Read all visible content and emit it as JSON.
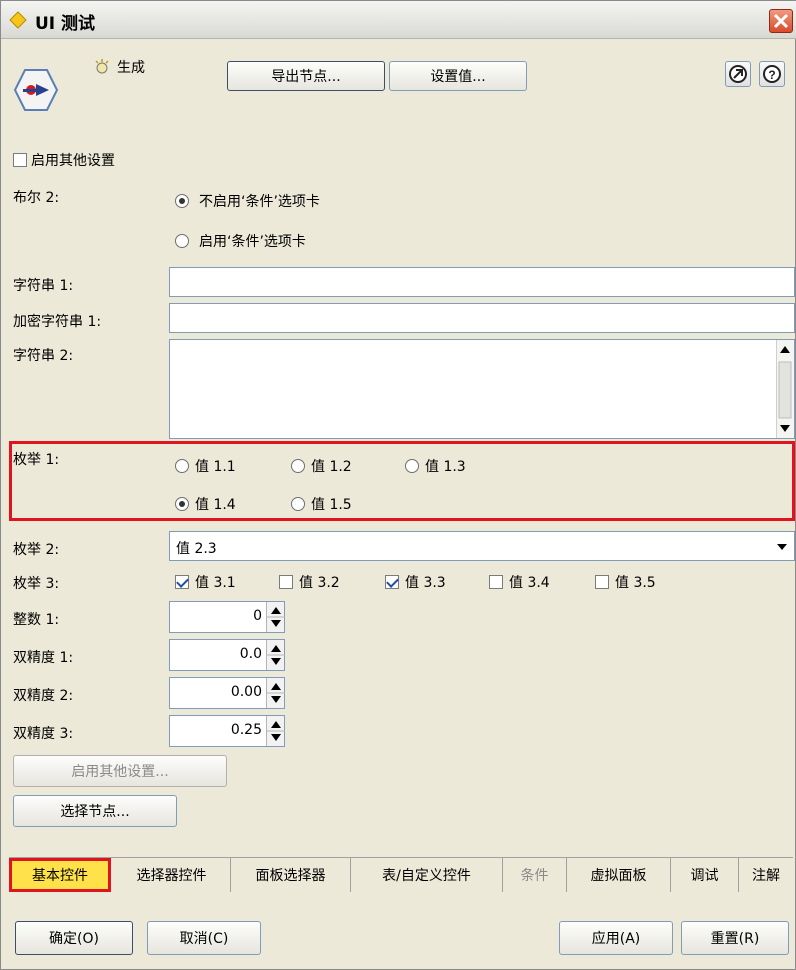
{
  "window": {
    "title": "UI 测试"
  },
  "toolbar": {
    "generate_label": "生成",
    "export_node_label": "导出节点...",
    "set_value_label": "设置值..."
  },
  "form": {
    "enable_other_settings_label": "启用其他设置",
    "bool2_label": "布尔 2:",
    "bool2_options": [
      "不启用‘条件’选项卡",
      "启用‘条件’选项卡"
    ],
    "bool2_selected": 0,
    "string1_label": "字符串 1:",
    "string1_value": "",
    "enc_string1_label": "加密字符串 1:",
    "enc_string1_value": "",
    "string2_label": "字符串 2:",
    "string2_value": "",
    "enum1_label": "枚举 1:",
    "enum1_options": [
      "值 1.1",
      "值 1.2",
      "值 1.3",
      "值 1.4",
      "值 1.5"
    ],
    "enum1_selected": 3,
    "enum2_label": "枚举 2:",
    "enum2_value": "值 2.3",
    "enum3_label": "枚举 3:",
    "enum3_options": [
      {
        "label": "值 3.1",
        "checked": true
      },
      {
        "label": "值 3.2",
        "checked": false
      },
      {
        "label": "值 3.3",
        "checked": true
      },
      {
        "label": "值 3.4",
        "checked": false
      },
      {
        "label": "值 3.5",
        "checked": false
      }
    ],
    "int1_label": "整数 1:",
    "int1_value": "0",
    "double1_label": "双精度 1:",
    "double1_value": "0.0",
    "double2_label": "双精度 2:",
    "double2_value": "0.00",
    "double3_label": "双精度 3:",
    "double3_value": "0.25",
    "enable_other_settings_btn": "启用其他设置...",
    "select_node_btn": "选择节点..."
  },
  "tabs": [
    {
      "label": "基本控件",
      "active": true,
      "disabled": false
    },
    {
      "label": "选择器控件",
      "active": false,
      "disabled": false
    },
    {
      "label": "面板选择器",
      "active": false,
      "disabled": false
    },
    {
      "label": "表/自定义控件",
      "active": false,
      "disabled": false
    },
    {
      "label": "条件",
      "active": false,
      "disabled": true
    },
    {
      "label": "虚拟面板",
      "active": false,
      "disabled": false
    },
    {
      "label": "调试",
      "active": false,
      "disabled": false
    },
    {
      "label": "注解",
      "active": false,
      "disabled": false
    }
  ],
  "footer": {
    "ok_label": "确定(O)",
    "cancel_label": "取消(C)",
    "apply_label": "应用(A)",
    "reset_label": "重置(R)"
  },
  "colors": {
    "highlight": "#e0141e",
    "active_tab": "#ffe14a",
    "bg": "#ece9d8"
  }
}
